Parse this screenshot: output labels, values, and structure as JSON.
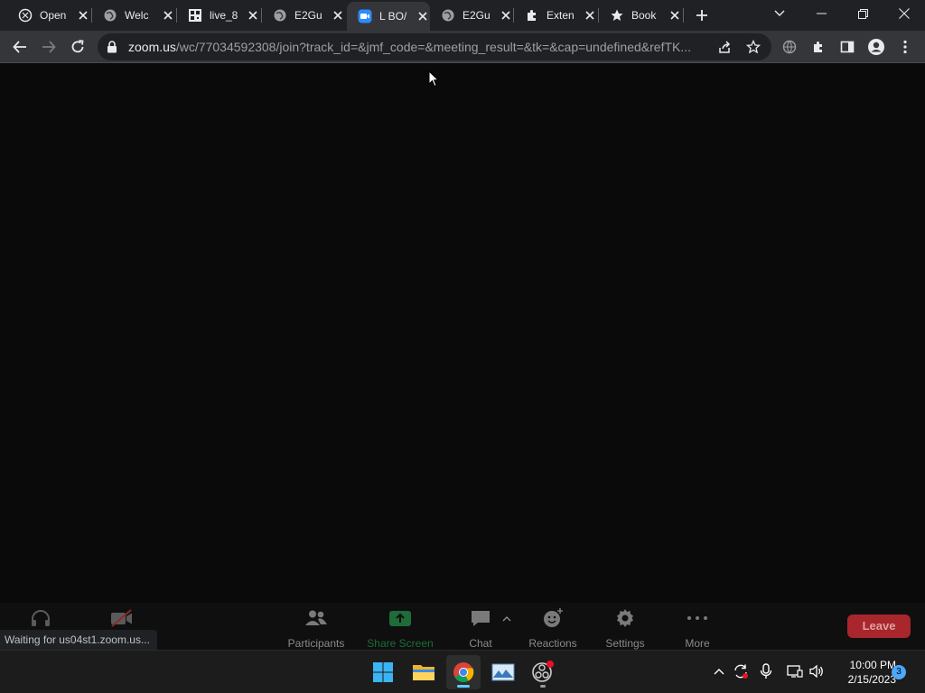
{
  "browser": {
    "tabs": [
      {
        "title": "Open",
        "icon": "openai-icon"
      },
      {
        "title": "Welc",
        "icon": "globe-icon"
      },
      {
        "title": "live_8",
        "icon": "qr-icon"
      },
      {
        "title": "E2Gu",
        "icon": "globe-icon"
      },
      {
        "title": "L BO/",
        "icon": "zoom-icon",
        "active": true
      },
      {
        "title": "E2Gu",
        "icon": "globe-icon"
      },
      {
        "title": "Exten",
        "icon": "puzzle-icon"
      },
      {
        "title": "Book",
        "icon": "star-icon"
      }
    ],
    "url_host": "zoom.us",
    "url_path": "/wc/77034592308/join?track_id=&jmf_code=&meeting_result=&tk=&cap=undefined&refTK..."
  },
  "zoom": {
    "participants_label": "Participants",
    "share_label": "Share Screen",
    "chat_label": "Chat",
    "reactions_label": "Reactions",
    "settings_label": "Settings",
    "more_label": "More",
    "leave_label": "Leave",
    "share_color": "#1f6b3a",
    "leave_color": "#a8262c"
  },
  "status_text": "Waiting for us04st1.zoom.us...",
  "taskbar": {
    "time": "10:00 PM",
    "date": "2/15/2023",
    "notification_count": "3"
  }
}
